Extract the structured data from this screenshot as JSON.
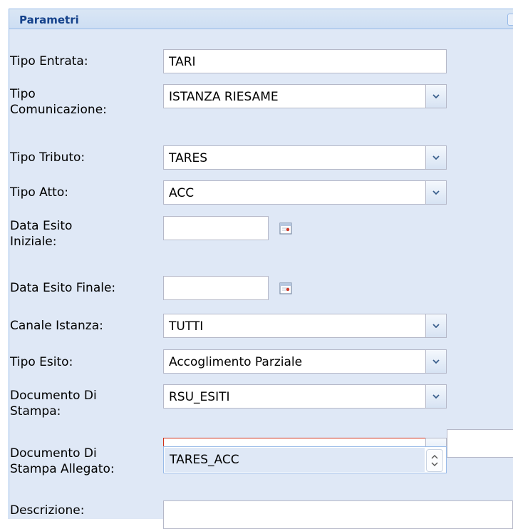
{
  "panel": {
    "title": "Parametri"
  },
  "fields": {
    "tipo_entrata": {
      "label": "Tipo Entrata:",
      "value": "TARI"
    },
    "tipo_comunicazione": {
      "label_line1": "Tipo",
      "label_line2": "Comunicazione:",
      "value": "ISTANZA RIESAME"
    },
    "tipo_tributo": {
      "label": "Tipo Tributo:",
      "value": "TARES"
    },
    "tipo_atto": {
      "label": "Tipo Atto:",
      "value": "ACC"
    },
    "data_esito_iniziale": {
      "label_line1": "Data Esito",
      "label_line2": "Iniziale:",
      "value": ""
    },
    "data_esito_finale": {
      "label": "Data Esito Finale:",
      "value": ""
    },
    "canale_istanza": {
      "label": "Canale Istanza:",
      "value": "TUTTI"
    },
    "tipo_esito": {
      "label": "Tipo Esito:",
      "value": "Accoglimento Parziale"
    },
    "documento_stampa": {
      "label_line1": "Documento Di",
      "label_line2": "Stampa:",
      "value": "RSU_ESITI"
    },
    "documento_stampa_allegato": {
      "label_line1": "Documento Di",
      "label_line2": "Stampa Allegato:",
      "value": ""
    },
    "descrizione": {
      "label": "Descrizione:",
      "value": ""
    }
  },
  "dropdown": {
    "options": [
      "TARES_ACC"
    ]
  },
  "icons": {
    "combo_trigger": "chevron-down-icon",
    "date_trigger": "calendar-icon",
    "spinner": "up-down-icon"
  },
  "colors": {
    "header_text": "#15428b",
    "invalid_border": "#d0301a",
    "panel_bg": "#dfe8f6"
  }
}
